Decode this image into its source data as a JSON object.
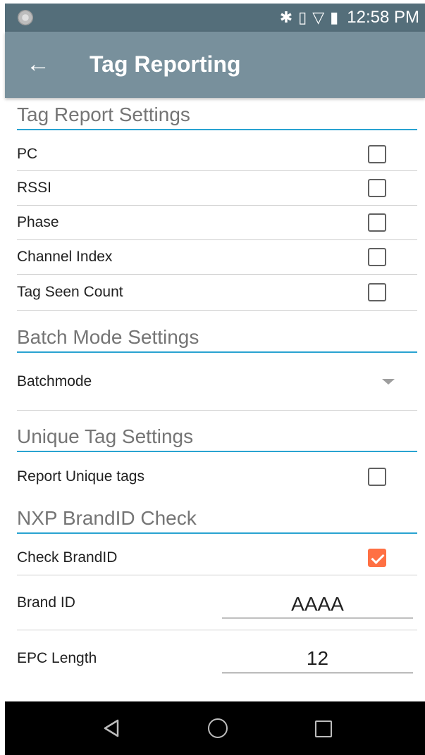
{
  "status_bar": {
    "time": "12:58 PM",
    "icons": [
      "bluetooth-icon",
      "vibrate-icon",
      "wifi-icon",
      "battery-charging-icon"
    ]
  },
  "app_bar": {
    "title": "Tag Reporting",
    "back_icon": "arrow-left-icon"
  },
  "sections": {
    "tag_report": {
      "header": "Tag Report Settings",
      "items": [
        {
          "label": "PC",
          "checked": false
        },
        {
          "label": "RSSI",
          "checked": false
        },
        {
          "label": "Phase",
          "checked": false
        },
        {
          "label": "Channel Index",
          "checked": false
        },
        {
          "label": "Tag Seen Count",
          "checked": false
        }
      ]
    },
    "batch_mode": {
      "header": "Batch Mode Settings",
      "dropdown_label": "Batchmode"
    },
    "unique_tag": {
      "header": "Unique Tag Settings",
      "item": {
        "label": "Report Unique tags",
        "checked": false
      }
    },
    "nxp_brand": {
      "header": "NXP BrandID Check",
      "check_item": {
        "label": "Check BrandID",
        "checked": true
      },
      "brand_id": {
        "label": "Brand ID",
        "value": "AAAA"
      },
      "epc_length": {
        "label": "EPC Length",
        "value": "12"
      }
    }
  },
  "nav_bar": {
    "icons": [
      "back-triangle-icon",
      "home-circle-icon",
      "recents-square-icon"
    ]
  },
  "colors": {
    "status_bar": "#546e7a",
    "app_bar": "#78909c",
    "accent_line": "#29a3d1",
    "checkbox_checked": "#ff7043"
  }
}
